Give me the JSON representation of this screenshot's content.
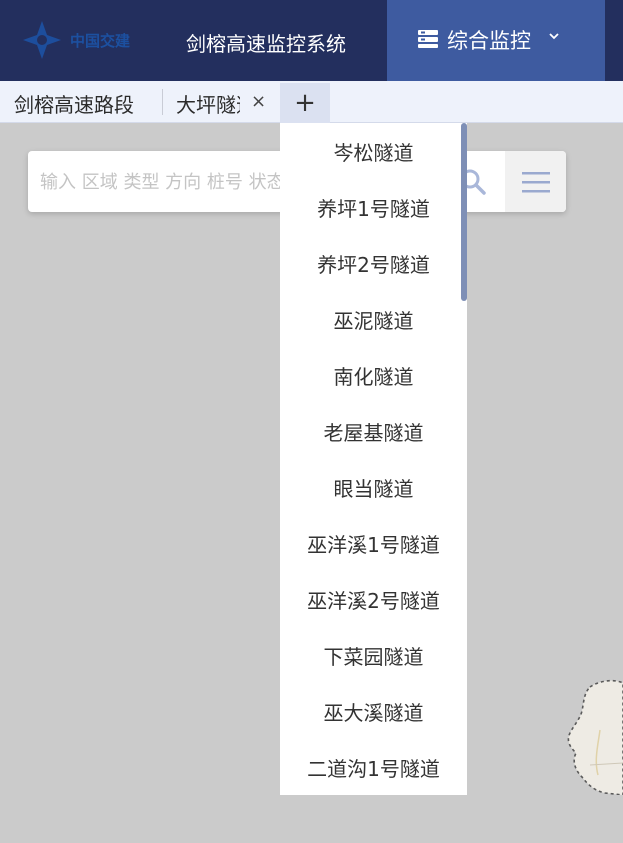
{
  "header": {
    "logo_text": "中国交建",
    "system_title": "剑榕高速监控系统",
    "monitor_label": "综合监控"
  },
  "tabs": [
    {
      "label": "剑榕高速路段"
    },
    {
      "label": "大坪隧道",
      "close": "×"
    }
  ],
  "add_tab_label": "+",
  "search": {
    "placeholder": "输入 区域 类型 方向 桩号 状态"
  },
  "dropdown": {
    "items": [
      "岑松隧道",
      "养坪1号隧道",
      "养坪2号隧道",
      "巫泥隧道",
      "南化隧道",
      "老屋基隧道",
      "眼当隧道",
      "巫洋溪1号隧道",
      "巫洋溪2号隧道",
      "下菜园隧道",
      "巫大溪隧道",
      "二道沟1号隧道"
    ]
  },
  "colors": {
    "header_bg": "#232f5e",
    "accent": "#3e5ba0",
    "map_bg": "#cbcbcb"
  }
}
